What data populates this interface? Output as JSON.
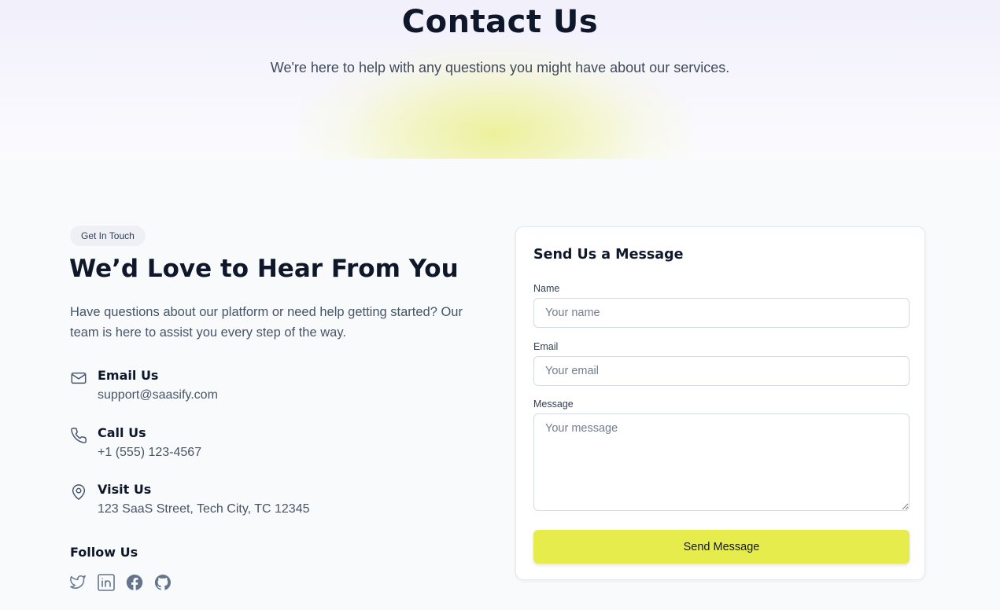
{
  "hero": {
    "title": "Contact Us",
    "subtitle": "We're here to help with any questions you might have about our services."
  },
  "contact_info": {
    "badge": "Get In Touch",
    "heading": "We’d Love to Hear From You",
    "intro": "Have questions about our platform or need help getting started? Our team is here to assist you every step of the way.",
    "items": [
      {
        "icon": "mail-icon",
        "title": "Email Us",
        "value": "support@saasify.com"
      },
      {
        "icon": "phone-icon",
        "title": "Call Us",
        "value": "+1 (555) 123-4567"
      },
      {
        "icon": "map-pin-icon",
        "title": "Visit Us",
        "value": "123 SaaS Street, Tech City, TC 12345"
      }
    ],
    "follow_title": "Follow Us",
    "social": [
      "twitter-icon",
      "linkedin-icon",
      "facebook-icon",
      "github-icon"
    ]
  },
  "form": {
    "title": "Send Us a Message",
    "name_label": "Name",
    "name_placeholder": "Your name",
    "email_label": "Email",
    "email_placeholder": "Your email",
    "message_label": "Message",
    "message_placeholder": "Your message",
    "submit_label": "Send Message"
  },
  "colors": {
    "accent": "#e7ec4d",
    "text_primary": "#0f172a",
    "text_muted": "#475569",
    "background": "#f8fafc"
  }
}
